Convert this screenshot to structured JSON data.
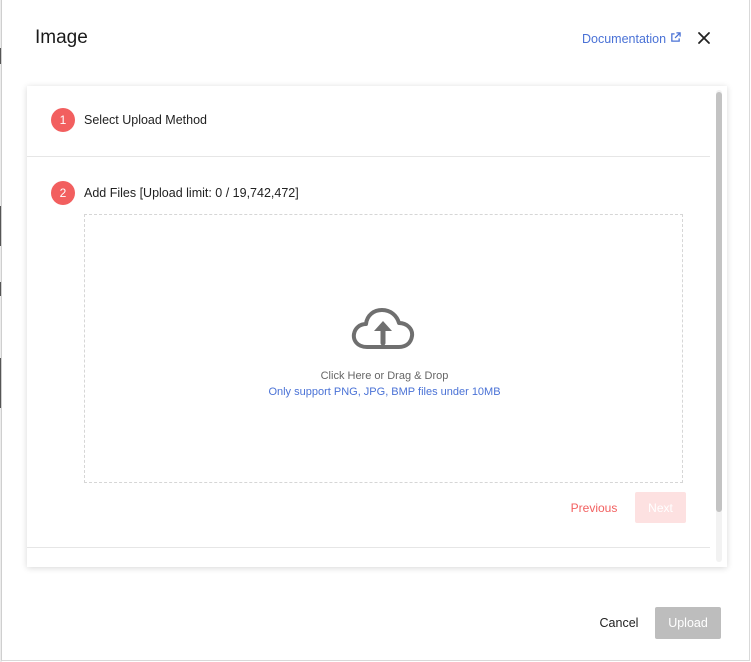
{
  "dialog": {
    "title": "Image",
    "documentation_label": "Documentation"
  },
  "steps": [
    {
      "number": "1",
      "label": "Select Upload Method"
    },
    {
      "number": "2",
      "label": "Add Files [Upload limit: 0 / 19,742,472]"
    }
  ],
  "dropzone": {
    "primary_text": "Click Here or Drag & Drop",
    "secondary_text": "Only support PNG, JPG, BMP files under 10MB"
  },
  "step_nav": {
    "previous_label": "Previous",
    "next_label": "Next"
  },
  "footer": {
    "cancel_label": "Cancel",
    "upload_label": "Upload"
  },
  "colors": {
    "accent": "#f25f5f",
    "link": "#4a72d6",
    "disabled": "#bdbdbd"
  },
  "icons": [
    "external-link-icon",
    "close-icon",
    "cloud-upload-icon"
  ]
}
